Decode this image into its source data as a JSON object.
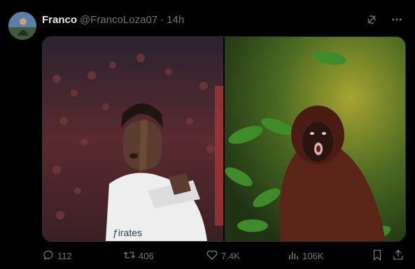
{
  "tweet": {
    "author_name": "Franco",
    "handle": "@FrancoLoza07",
    "separator": "·",
    "time": "14h",
    "media": {
      "left_jersey_text": "ƒirates",
      "left_desc": "football-player-photo",
      "right_desc": "howler-monkey-photo"
    },
    "stats": {
      "replies": "112",
      "reposts": "406",
      "likes": "7.4K",
      "views": "106K"
    }
  },
  "icons": [
    "grok-icon",
    "more-icon",
    "reply-icon",
    "repost-icon",
    "like-icon",
    "views-icon",
    "bookmark-icon",
    "share-icon"
  ],
  "colors": {
    "background": "#000000",
    "text": "#e7e9ea",
    "muted": "#71767b",
    "border": "#2f3336"
  }
}
